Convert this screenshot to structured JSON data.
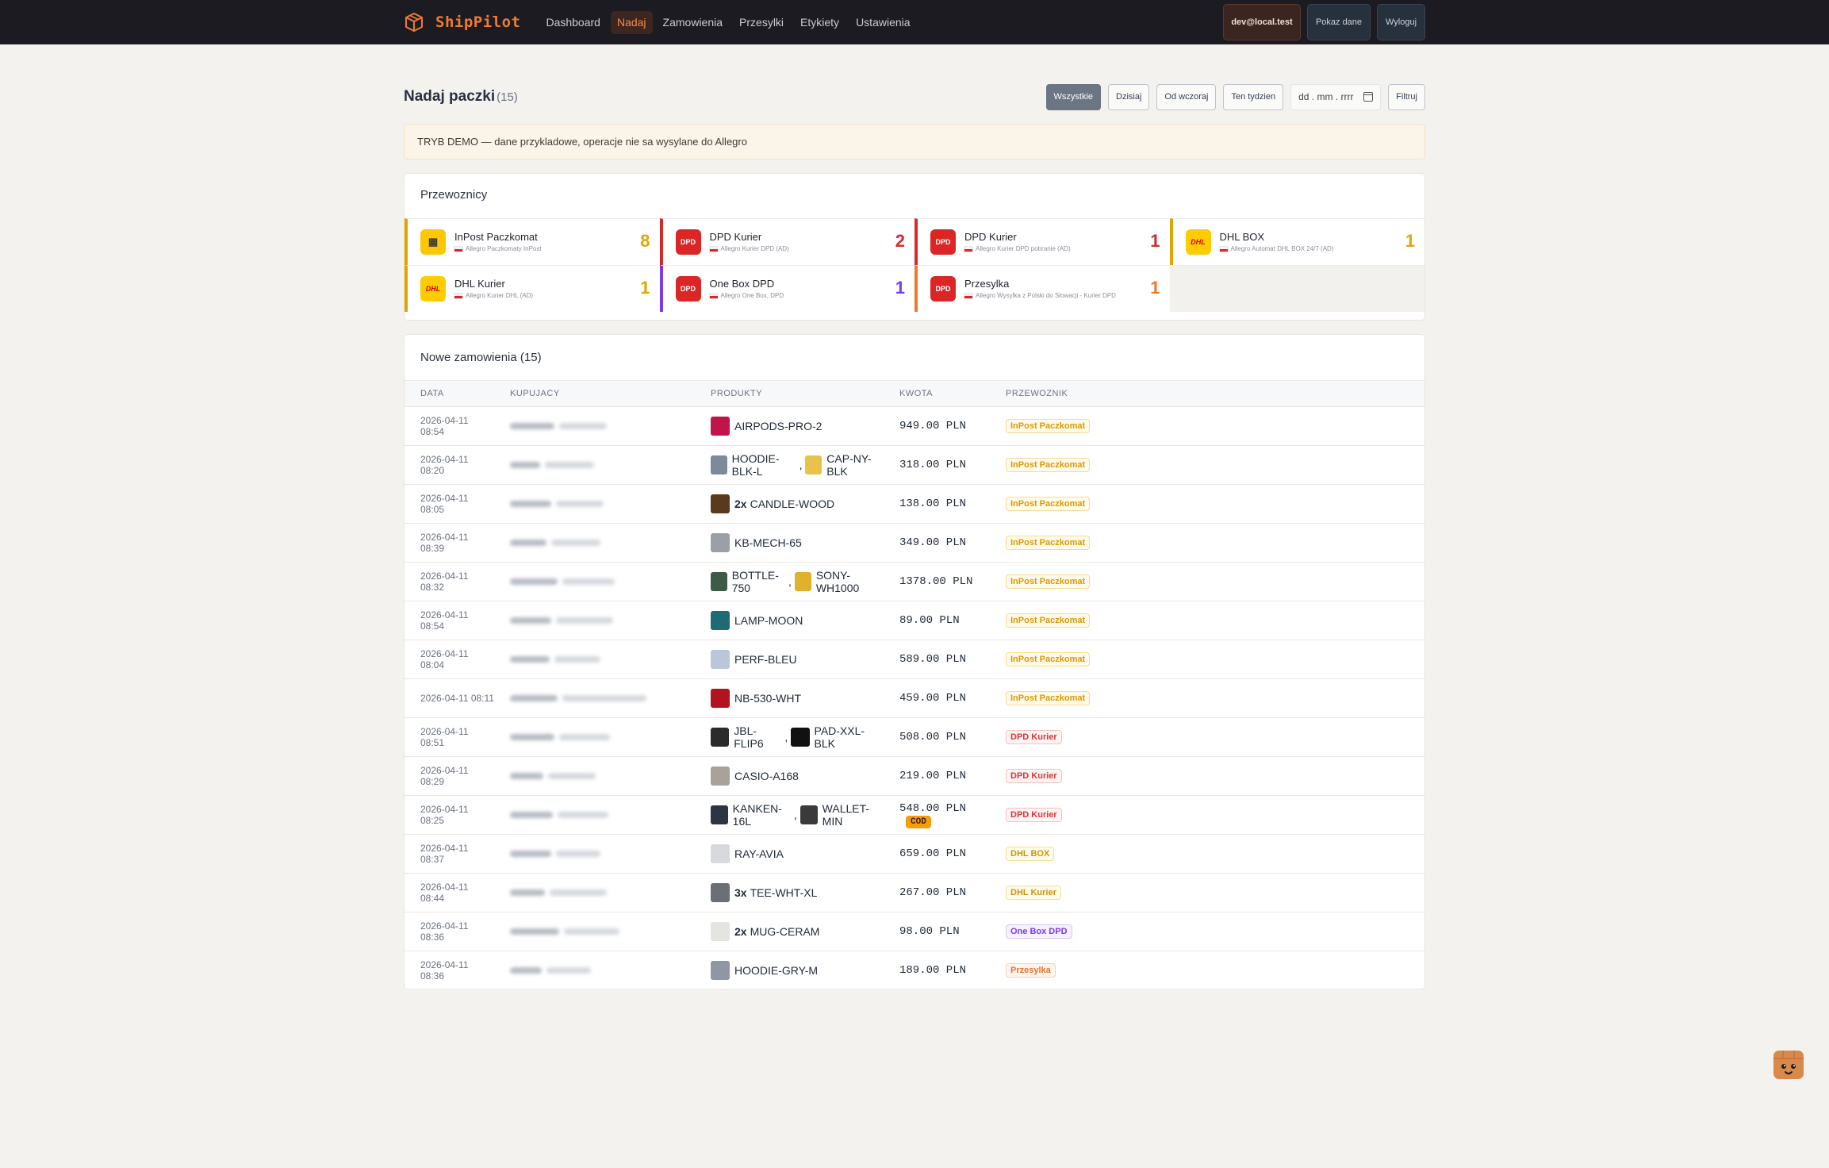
{
  "app": {
    "brand": "ShipPilot",
    "nav": [
      {
        "label": "Dashboard",
        "active": false
      },
      {
        "label": "Nadaj",
        "active": true
      },
      {
        "label": "Zamowienia",
        "active": false
      },
      {
        "label": "Przesylki",
        "active": false
      },
      {
        "label": "Etykiety",
        "active": false
      },
      {
        "label": "Ustawienia",
        "active": false
      }
    ],
    "user_email": "dev@local.test",
    "show_data_label": "Pokaz dane",
    "logout_label": "Wyloguj"
  },
  "header": {
    "title": "Nadaj paczki",
    "count": "(15)",
    "filters": [
      {
        "label": "Wszystkie",
        "active": true
      },
      {
        "label": "Dzisiaj",
        "active": false
      },
      {
        "label": "Od wczoraj",
        "active": false
      },
      {
        "label": "Ten tydzien",
        "active": false
      }
    ],
    "date_placeholder": "dd . mm . rrrr",
    "filter_button": "Filtruj"
  },
  "banner": "TRYB DEMO — dane przykladowe, operacje nie sa wysylane do Allegro",
  "carriers": {
    "title": "Przewoznicy",
    "items": [
      {
        "name": "InPost Paczkomat",
        "sub": "Allegro Paczkomaty InPost",
        "count": "8",
        "logo": "inpost-icon",
        "color": "#e0a500"
      },
      {
        "name": "DPD Kurier",
        "sub": "Allegro Kurier DPD (AD)",
        "count": "2",
        "logo": "DPD",
        "color": "#d42a2a"
      },
      {
        "name": "DPD Kurier",
        "sub": "Allegro Kurier DPD pobranie (AD)",
        "count": "1",
        "logo": "DPD",
        "color": "#d42a2a"
      },
      {
        "name": "DHL BOX",
        "sub": "Allegro Automat DHL BOX 24/7 (AD)",
        "count": "1",
        "logo": "DHL",
        "color": "#e0a500"
      },
      {
        "name": "DHL Kurier",
        "sub": "Allegro Kurier DHL (AD)",
        "count": "1",
        "logo": "DHL",
        "color": "#e0a500"
      },
      {
        "name": "One Box DPD",
        "sub": "Allegro One Box, DPD",
        "count": "1",
        "logo": "DPD",
        "color": "#7c3aed"
      },
      {
        "name": "Przesylka",
        "sub": "Allegro Wysylka z Polski do Slowacji - Kurier DPD",
        "count": "1",
        "logo": "DPD",
        "color": "#ea7a2c"
      }
    ]
  },
  "orders": {
    "title": "Nowe zamowienia (15)",
    "columns": [
      "DATA",
      "KUPUJACY",
      "PRODUKTY",
      "KWOTA",
      "PRZEWOZNIK"
    ],
    "rows": [
      {
        "date": "2026-04-11 08:54",
        "buyer": "",
        "products": [
          {
            "qty": "",
            "sku": "AIRPODS-PRO-2",
            "thumb": "#c0154a"
          }
        ],
        "amount": "949.00 PLN",
        "cod": "",
        "carrier": "InPost Paczkomat",
        "carrier_class": "b-inpost"
      },
      {
        "date": "2026-04-11 08:20",
        "buyer": "",
        "products": [
          {
            "qty": "",
            "sku": "HOODIE-BLK-L",
            "thumb": "#7d8a99"
          },
          {
            "qty": "",
            "sku": "CAP-NY-BLK",
            "thumb": "#e8c34a"
          }
        ],
        "amount": "318.00 PLN",
        "cod": "",
        "carrier": "InPost Paczkomat",
        "carrier_class": "b-inpost"
      },
      {
        "date": "2026-04-11 08:05",
        "buyer": "",
        "products": [
          {
            "qty": "2x",
            "sku": "CANDLE-WOOD",
            "thumb": "#5a3a1c"
          }
        ],
        "amount": "138.00 PLN",
        "cod": "",
        "carrier": "InPost Paczkomat",
        "carrier_class": "b-inpost"
      },
      {
        "date": "2026-04-11 08:39",
        "buyer": "",
        "products": [
          {
            "qty": "",
            "sku": "KB-MECH-65",
            "thumb": "#9aa0a6"
          }
        ],
        "amount": "349.00 PLN",
        "cod": "",
        "carrier": "InPost Paczkomat",
        "carrier_class": "b-inpost"
      },
      {
        "date": "2026-04-11 08:32",
        "buyer": "",
        "products": [
          {
            "qty": "",
            "sku": "BOTTLE-750",
            "thumb": "#3e5a48"
          },
          {
            "qty": "",
            "sku": "SONY-WH1000",
            "thumb": "#e0b22a"
          }
        ],
        "amount": "1378.00 PLN",
        "cod": "",
        "carrier": "InPost Paczkomat",
        "carrier_class": "b-inpost"
      },
      {
        "date": "2026-04-11 08:54",
        "buyer": "",
        "products": [
          {
            "qty": "",
            "sku": "LAMP-MOON",
            "thumb": "#1f6b73"
          }
        ],
        "amount": "89.00 PLN",
        "cod": "",
        "carrier": "InPost Paczkomat",
        "carrier_class": "b-inpost"
      },
      {
        "date": "2026-04-11 08:04",
        "buyer": "",
        "products": [
          {
            "qty": "",
            "sku": "PERF-BLEU",
            "thumb": "#b9c7d8"
          }
        ],
        "amount": "589.00 PLN",
        "cod": "",
        "carrier": "InPost Paczkomat",
        "carrier_class": "b-inpost"
      },
      {
        "date": "2026-04-11 08:11",
        "buyer": "",
        "products": [
          {
            "qty": "",
            "sku": "NB-530-WHT",
            "thumb": "#b3121f"
          }
        ],
        "amount": "459.00 PLN",
        "cod": "",
        "carrier": "InPost Paczkomat",
        "carrier_class": "b-inpost"
      },
      {
        "date": "2026-04-11 08:51",
        "buyer": "",
        "products": [
          {
            "qty": "",
            "sku": "JBL-FLIP6",
            "thumb": "#2b2b2b"
          },
          {
            "qty": "",
            "sku": "PAD-XXL-BLK",
            "thumb": "#111111"
          }
        ],
        "amount": "508.00 PLN",
        "cod": "",
        "carrier": "DPD Kurier",
        "carrier_class": "b-dpd"
      },
      {
        "date": "2026-04-11 08:29",
        "buyer": "",
        "products": [
          {
            "qty": "",
            "sku": "CASIO-A168",
            "thumb": "#a8a29a"
          }
        ],
        "amount": "219.00 PLN",
        "cod": "",
        "carrier": "DPD Kurier",
        "carrier_class": "b-dpd"
      },
      {
        "date": "2026-04-11 08:25",
        "buyer": "",
        "products": [
          {
            "qty": "",
            "sku": "KANKEN-16L",
            "thumb": "#2d3442"
          },
          {
            "qty": "",
            "sku": "WALLET-MIN",
            "thumb": "#3a3a3a"
          }
        ],
        "amount": "548.00 PLN",
        "cod": "COD",
        "carrier": "DPD Kurier",
        "carrier_class": "b-dpd"
      },
      {
        "date": "2026-04-11 08:37",
        "buyer": "",
        "products": [
          {
            "qty": "",
            "sku": "RAY-AVIA",
            "thumb": "#d7d9dc"
          }
        ],
        "amount": "659.00 PLN",
        "cod": "",
        "carrier": "DHL BOX",
        "carrier_class": "b-dhl"
      },
      {
        "date": "2026-04-11 08:44",
        "buyer": "",
        "products": [
          {
            "qty": "3x",
            "sku": "TEE-WHT-XL",
            "thumb": "#6b6f76"
          }
        ],
        "amount": "267.00 PLN",
        "cod": "",
        "carrier": "DHL Kurier",
        "carrier_class": "b-dhl"
      },
      {
        "date": "2026-04-11 08:36",
        "buyer": "",
        "products": [
          {
            "qty": "2x",
            "sku": "MUG-CERAM",
            "thumb": "#e4e4e1"
          }
        ],
        "amount": "98.00 PLN",
        "cod": "",
        "carrier": "One Box DPD",
        "carrier_class": "b-onebox"
      },
      {
        "date": "2026-04-11 08:36",
        "buyer": "",
        "products": [
          {
            "qty": "",
            "sku": "HOODIE-GRY-M",
            "thumb": "#8e97a3"
          }
        ],
        "amount": "189.00 PLN",
        "cod": "",
        "carrier": "Przesylka",
        "carrier_class": "b-przesylka"
      }
    ]
  }
}
